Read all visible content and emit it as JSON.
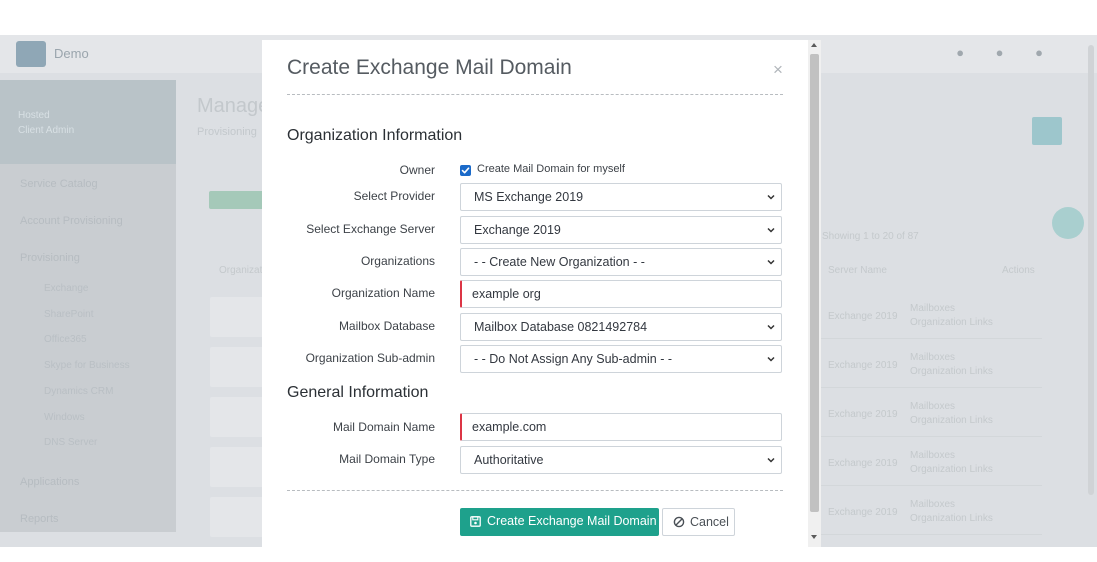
{
  "background_app": {
    "brand": "Demo",
    "sidebar": {
      "user_line1": "Hosted",
      "user_line2": "Client Admin",
      "items": [
        "Service Catalog",
        "Account Provisioning",
        "Provisioning",
        "Applications",
        "Reports"
      ],
      "sub_items": [
        "Exchange",
        "SharePoint",
        "Office365",
        "Skype for Business",
        "Dynamics CRM",
        "Windows",
        "DNS Server"
      ]
    },
    "main": {
      "title": "Manage",
      "breadcrumb": "Provisioning",
      "paging": "Showing 1 to 20 of 87",
      "columns": [
        "Organization",
        "Server Name",
        "Actions"
      ],
      "row_server": "Exchange 2019",
      "row_status": "Mailboxes",
      "row_action": "Organization Links"
    }
  },
  "modal": {
    "title": "Create Exchange Mail Domain",
    "close_icon": "×",
    "section_org": "Organization Information",
    "section_general": "General Information",
    "fields": {
      "owner": {
        "label": "Owner",
        "checkbox_label": "Create Mail Domain for myself",
        "checked": true
      },
      "provider": {
        "label": "Select Provider",
        "value": "MS Exchange 2019"
      },
      "exchange_server": {
        "label": "Select Exchange Server",
        "value": "Exchange 2019"
      },
      "organizations": {
        "label": "Organizations",
        "value": "- - Create New Organization - -"
      },
      "organization_name": {
        "label": "Organization Name",
        "value": "example org"
      },
      "mailbox_database": {
        "label": "Mailbox Database",
        "value": "Mailbox Database 0821492784"
      },
      "sub_admin": {
        "label": "Organization Sub-admin",
        "value": "- - Do Not Assign Any Sub-admin - -"
      },
      "mail_domain_name": {
        "label": "Mail Domain Name",
        "value": "example.com"
      },
      "mail_domain_type": {
        "label": "Mail Domain Type",
        "value": "Authoritative"
      }
    },
    "buttons": {
      "create": {
        "label": "Create Exchange Mail Domain",
        "icon": "save-icon"
      },
      "cancel": {
        "label": "Cancel",
        "icon": "ban-icon"
      }
    }
  },
  "colors": {
    "primary": "#1ea18c",
    "checkbox": "#1b6ac9",
    "required_border": "#dc3545",
    "overlay": "#dcdfe3"
  }
}
